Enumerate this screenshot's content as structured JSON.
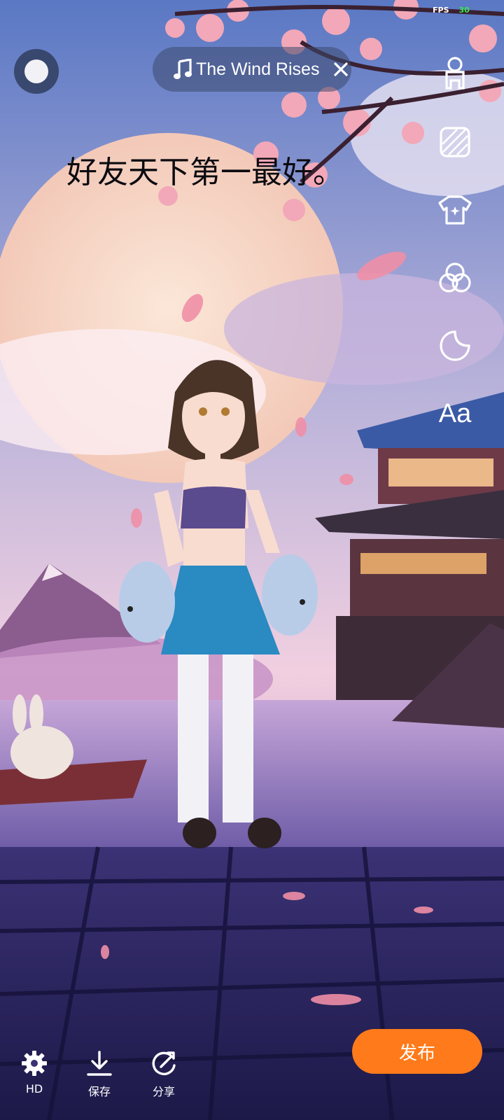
{
  "status": {
    "fps_label": "FPS",
    "fps_value": "30"
  },
  "music": {
    "title": "The Wind Rises",
    "icon": "music-note-icon",
    "close_icon": "close-icon"
  },
  "caption": {
    "text": "好友天下第一最好。"
  },
  "right_tools": [
    {
      "name": "avatar-icon"
    },
    {
      "name": "background-icon"
    },
    {
      "name": "outfit-icon"
    },
    {
      "name": "filter-icon"
    },
    {
      "name": "sticker-icon"
    },
    {
      "name": "text-tool",
      "label": "Aa"
    }
  ],
  "bottom": {
    "hd_label": "HD",
    "save_label": "保存",
    "share_label": "分享",
    "publish_label": "发布"
  },
  "colors": {
    "publish": "#ff7a1a",
    "fps_value": "#39e64b"
  }
}
